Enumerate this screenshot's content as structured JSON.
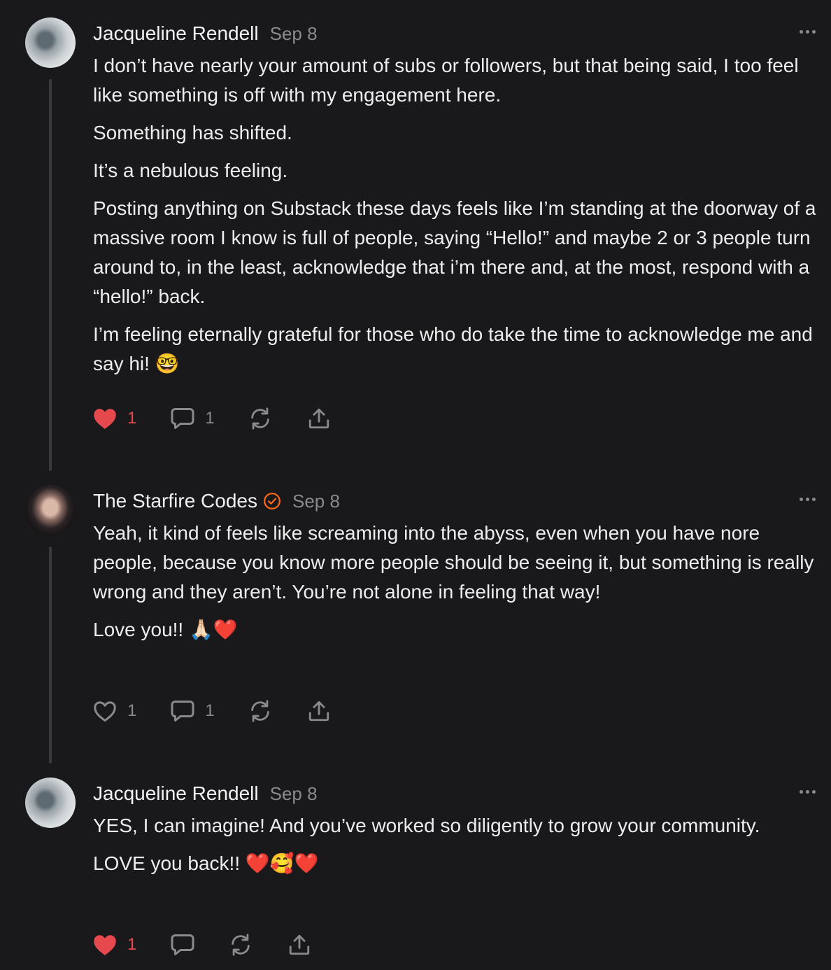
{
  "comments": [
    {
      "author": "Jacqueline Rendell",
      "date": "Sep 8",
      "paragraphs": [
        "I don’t have nearly your amount of subs or followers, but that being said, I too feel like something is off with my engagement here.",
        "Something has shifted.",
        "It’s a nebulous feeling.",
        "Posting anything on Substack these days feels like I’m standing at the doorway of a massive room I know is full of people, saying “Hello!” and maybe 2 or 3 people turn around to, in the least, acknowledge that i’m there and, at the most, respond with a “hello!” back.",
        "I’m feeling eternally grateful for those who do take the time to acknowledge me and say hi! 🤓"
      ],
      "likes": "1",
      "liked": true,
      "replies": "1"
    },
    {
      "author": "The Starfire Codes",
      "date": "Sep 8",
      "verified": true,
      "paragraphs": [
        "Yeah, it kind of feels like screaming into the abyss, even when you have nore people, because you know more people should be seeing it, but something is really wrong and they aren’t. You’re not alone in feeling that way!",
        "Love you!! 🙏🏻❤️"
      ],
      "likes": "1",
      "liked": false,
      "replies": "1"
    },
    {
      "author": "Jacqueline Rendell",
      "date": "Sep 8",
      "paragraphs": [
        "YES, I can imagine! And you’ve worked so diligently to grow your community.",
        "LOVE you back!! ❤️🥰❤️"
      ],
      "likes": "1",
      "liked": true,
      "replies": ""
    }
  ],
  "icons": {
    "like": "heart-icon",
    "reply": "speech-bubble-icon",
    "restack": "restack-icon",
    "share": "share-icon",
    "more": "more-options-icon",
    "verified": "verified-badge-icon"
  },
  "colors": {
    "background": "#19191b",
    "liked": "#e5484d",
    "verified": "#ff6719",
    "muted": "#8a8a8e"
  }
}
